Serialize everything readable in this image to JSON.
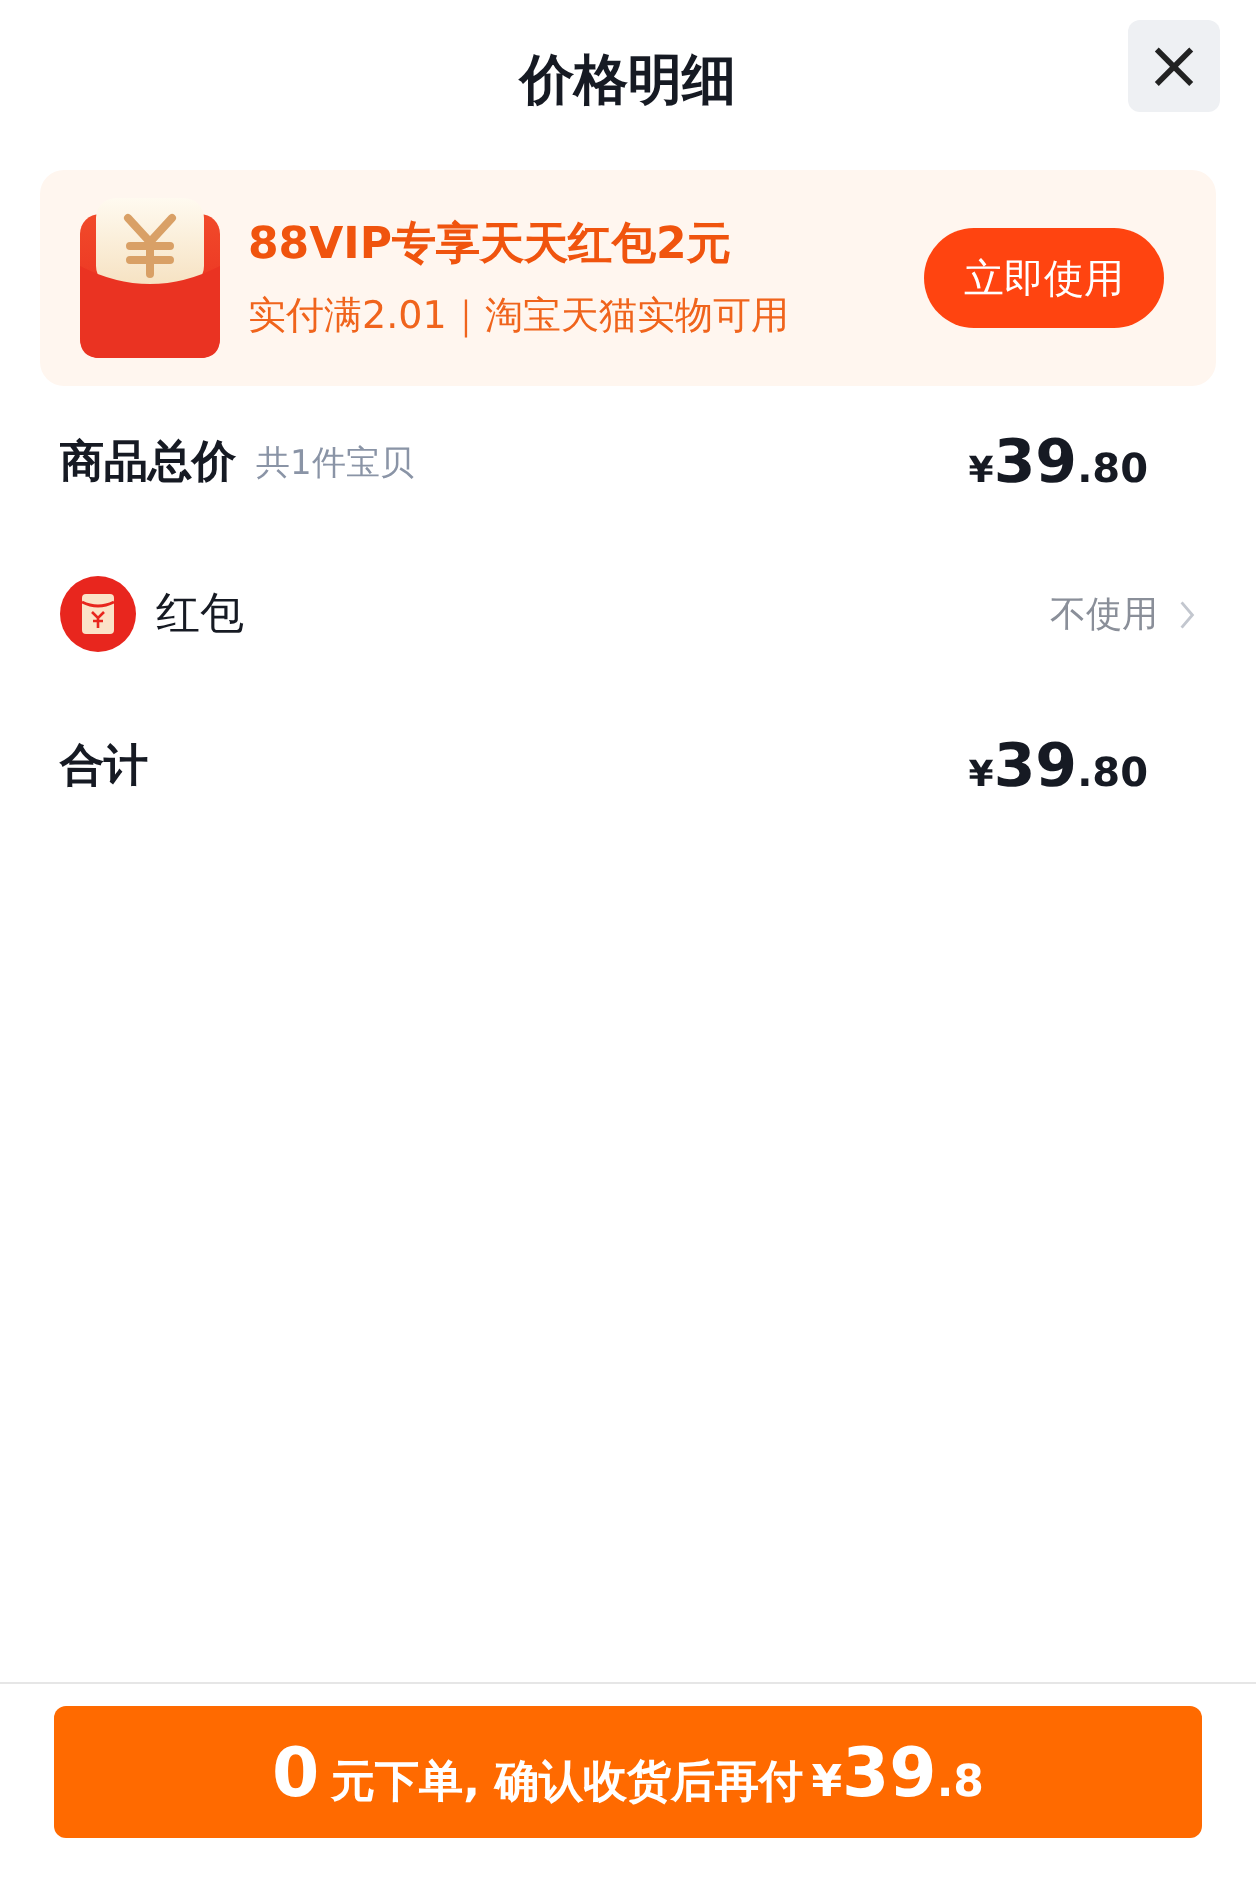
{
  "header": {
    "title": "价格明细",
    "close_label": "×"
  },
  "promo": {
    "title": "88VIP专享天天红包2元",
    "subtitle": "实付满2.01｜淘宝天猫实物可用",
    "button": "立即使用"
  },
  "rows": [
    {
      "kind": "price",
      "label": "商品总价",
      "note": "共1件宝贝",
      "price": {
        "currency": "¥",
        "integer": "39",
        "decimal": ".80"
      }
    },
    {
      "kind": "option",
      "label": "红包",
      "value": "不使用"
    },
    {
      "kind": "price",
      "label": "合计",
      "price": {
        "currency": "¥",
        "integer": "39",
        "decimal": ".80"
      }
    }
  ],
  "checkout": {
    "lead": "0",
    "text": "元下单, 确认收货后再付",
    "currency": "¥",
    "integer": "39",
    "decimal": ".8"
  }
}
